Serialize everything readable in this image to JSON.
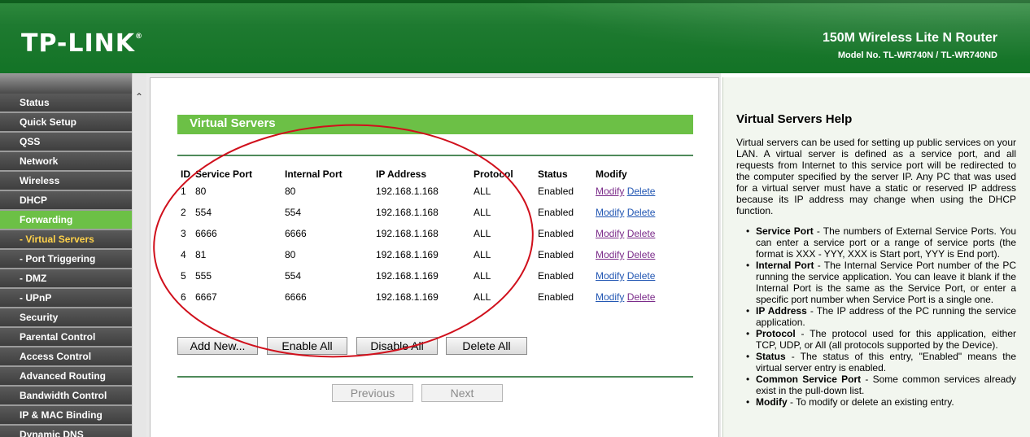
{
  "header": {
    "logo": "TP-LINK",
    "product": "150M Wireless Lite N Router",
    "model": "Model No. TL-WR740N / TL-WR740ND"
  },
  "sidebar": {
    "items": [
      {
        "label": "Status"
      },
      {
        "label": "Quick Setup"
      },
      {
        "label": "QSS"
      },
      {
        "label": "Network"
      },
      {
        "label": "Wireless"
      },
      {
        "label": "DHCP"
      },
      {
        "label": "Forwarding"
      },
      {
        "label": "- Virtual Servers"
      },
      {
        "label": "- Port Triggering"
      },
      {
        "label": "- DMZ"
      },
      {
        "label": "- UPnP"
      },
      {
        "label": "Security"
      },
      {
        "label": "Parental Control"
      },
      {
        "label": "Access Control"
      },
      {
        "label": "Advanced Routing"
      },
      {
        "label": "Bandwidth Control"
      },
      {
        "label": "IP & MAC Binding"
      },
      {
        "label": "Dynamic DNS"
      }
    ]
  },
  "main": {
    "title": "Virtual Servers",
    "columns": [
      "ID",
      "Service Port",
      "Internal Port",
      "IP Address",
      "Protocol",
      "Status",
      "Modify"
    ],
    "rows": [
      {
        "id": "1",
        "service_port": "80",
        "internal_port": "80",
        "ip": "192.168.1.168",
        "protocol": "ALL",
        "status": "Enabled",
        "modify": "Modify",
        "delete": "Delete"
      },
      {
        "id": "2",
        "service_port": "554",
        "internal_port": "554",
        "ip": "192.168.1.168",
        "protocol": "ALL",
        "status": "Enabled",
        "modify": "Modify",
        "delete": "Delete"
      },
      {
        "id": "3",
        "service_port": "6666",
        "internal_port": "6666",
        "ip": "192.168.1.168",
        "protocol": "ALL",
        "status": "Enabled",
        "modify": "Modify",
        "delete": "Delete"
      },
      {
        "id": "4",
        "service_port": "81",
        "internal_port": "80",
        "ip": "192.168.1.169",
        "protocol": "ALL",
        "status": "Enabled",
        "modify": "Modify",
        "delete": "Delete"
      },
      {
        "id": "5",
        "service_port": "555",
        "internal_port": "554",
        "ip": "192.168.1.169",
        "protocol": "ALL",
        "status": "Enabled",
        "modify": "Modify",
        "delete": "Delete"
      },
      {
        "id": "6",
        "service_port": "6667",
        "internal_port": "6666",
        "ip": "192.168.1.169",
        "protocol": "ALL",
        "status": "Enabled",
        "modify": "Modify",
        "delete": "Delete"
      }
    ],
    "buttons": {
      "add_new": "Add New...",
      "enable_all": "Enable All",
      "disable_all": "Disable All",
      "delete_all": "Delete All",
      "previous": "Previous",
      "next": "Next"
    }
  },
  "help": {
    "title": "Virtual Servers Help",
    "intro": "Virtual servers can be used for setting up public services on your LAN. A virtual server is defined as a service port, and all requests from Internet to this service port will be redirected to the computer specified by the server IP. Any PC that was used for a virtual server must have a static or reserved IP address because its IP address may change when using the DHCP function.",
    "items": [
      {
        "term": "Service Port",
        "text": " - The numbers of External Service Ports. You can enter a service port or a range of service ports (the format is XXX - YYY, XXX is Start port, YYY is End port)."
      },
      {
        "term": "Internal Port",
        "text": " - The Internal Service Port number of the PC running the service application. You can leave it blank if the Internal Port is the same as the Service Port, or enter a specific port number when Service Port is a single one."
      },
      {
        "term": "IP Address",
        "text": " - The IP address of the PC running the service application."
      },
      {
        "term": "Protocol",
        "text": " - The protocol used for this application, either TCP, UDP, or All (all protocols supported by the Device)."
      },
      {
        "term": "Status",
        "text": " - The status of this entry, \"Enabled\" means the virtual server entry is enabled."
      },
      {
        "term": "Common Service Port",
        "text": " - Some common services already exist in the pull-down list."
      },
      {
        "term": "Modify",
        "text": " - To modify or delete an existing entry."
      }
    ]
  },
  "colors": {
    "header_green": "#1e7a30",
    "accent_green": "#6cc046",
    "menu_dark": "#444444",
    "annotation_red": "#d0101c"
  }
}
